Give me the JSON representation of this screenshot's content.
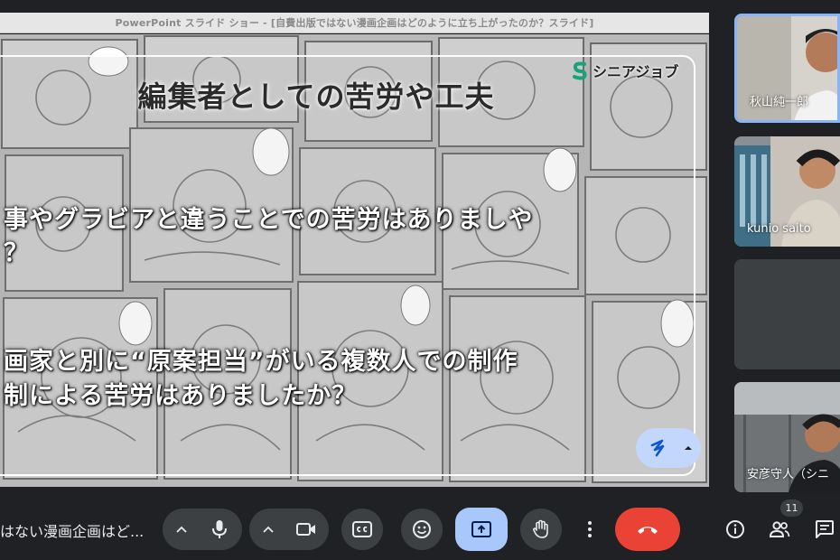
{
  "window": {
    "title": "PowerPoint スライド ショー - [自費出版ではない漫画企画はどのように立ち上がったのか？スライド]"
  },
  "slide": {
    "logo_text": "シニアジョブ",
    "title": "編集者としての苦労や工夫",
    "lines": [
      "事やグラビアと違うことでの苦労はありましや",
      "？",
      "画家と別に“原案担当”がいる複数人での制作",
      "制による苦労はありましたか？"
    ]
  },
  "participants": [
    {
      "name": "秋山純一郎",
      "active_speaker": true
    },
    {
      "name": "kunio saito",
      "active_speaker": false
    },
    {
      "name": "",
      "active_speaker": false
    },
    {
      "name": "安彦守人（シニ",
      "active_speaker": false
    }
  ],
  "toolbar": {
    "meeting_title": "はない漫画企画はど...",
    "participant_count": "11"
  },
  "colors": {
    "accent_blue": "#8ab4f8",
    "present_button": "#a8c7fa",
    "leave_button": "#ea4335",
    "control_background": "#3c4043",
    "page_background": "#202124"
  },
  "icons": [
    "chevron-up-icon",
    "microphone-icon",
    "camera-icon",
    "captions-icon",
    "emoji-icon",
    "present-icon",
    "raise-hand-icon",
    "more-vert-icon",
    "call-end-icon",
    "info-icon",
    "people-icon",
    "chat-icon",
    "laser-pointer-icon"
  ]
}
